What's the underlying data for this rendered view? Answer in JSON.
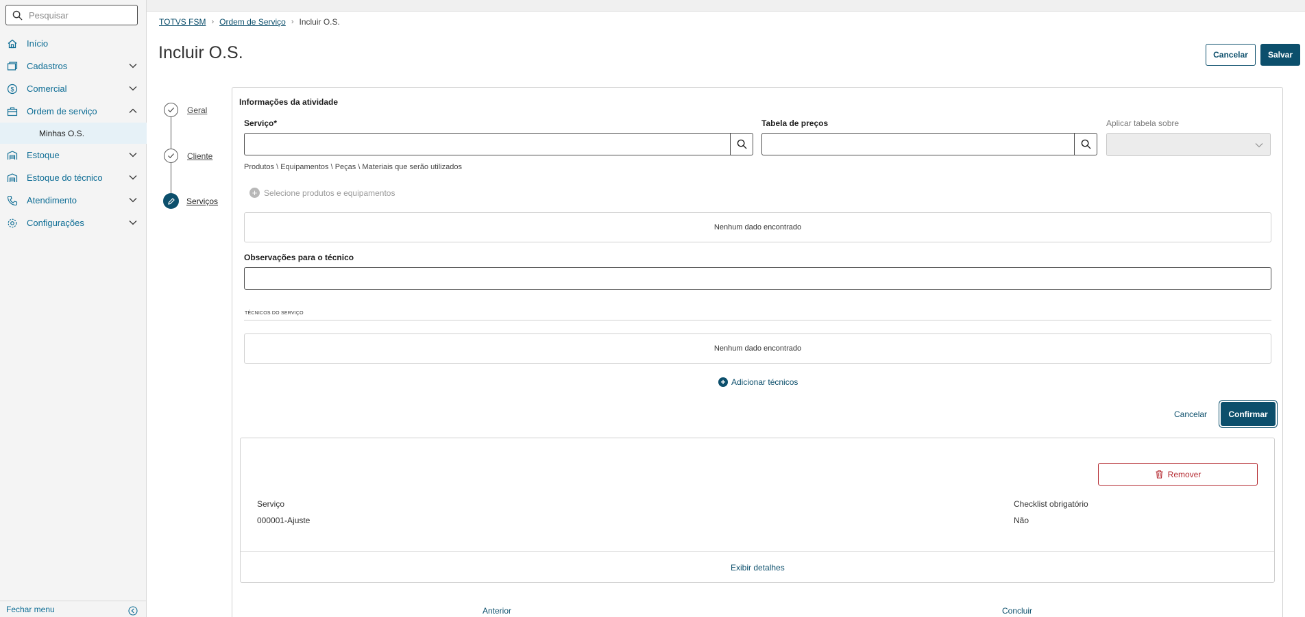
{
  "sidebar": {
    "search_placeholder": "Pesquisar",
    "items": [
      {
        "label": "Início",
        "icon": "home-icon"
      },
      {
        "label": "Cadastros",
        "icon": "cards-icon"
      },
      {
        "label": "Comercial",
        "icon": "dollar-icon"
      },
      {
        "label": "Ordem de serviço",
        "icon": "briefcase-icon"
      },
      {
        "label": "Estoque",
        "icon": "warehouse-icon"
      },
      {
        "label": "Estoque do técnico",
        "icon": "warehouse-icon"
      },
      {
        "label": "Atendimento",
        "icon": "phone-icon"
      },
      {
        "label": "Configurações",
        "icon": "gear-icon"
      }
    ],
    "subitem": "Minhas O.S.",
    "close_menu": "Fechar menu"
  },
  "breadcrumb": {
    "home": "TOTVS FSM",
    "parent": "Ordem de Serviço",
    "current": "Incluir O.S."
  },
  "page": {
    "title": "Incluir O.S.",
    "cancel": "Cancelar",
    "save": "Salvar"
  },
  "steps": [
    "Geral",
    "Cliente",
    "Serviços"
  ],
  "form": {
    "section_title": "Informações da atividade",
    "service_label": "Serviço*",
    "price_table_label": "Tabela de preços",
    "apply_table_label": "Aplicar tabela sobre",
    "products_hint": "Produtos \\ Equipamentos \\ Peças \\ Materiais que serão utilizados",
    "select_products": "Selecione produtos e equipamentos",
    "empty_text": "Nenhum dado encontrado",
    "notes_label": "Observações para o técnico",
    "techs_header": "TÉCNICOS DO SERVIÇO",
    "add_techs": "Adicionar técnicos",
    "cancel": "Cancelar",
    "confirm": "Confirmar"
  },
  "card": {
    "remove": "Remover",
    "service_label": "Serviço",
    "service_value": "000001-Ajuste",
    "checklist_label": "Checklist obrigatório",
    "checklist_value": "Não",
    "details_link": "Exibir detalhes"
  },
  "footer": {
    "previous": "Anterior",
    "finish": "Concluir"
  },
  "colors": {
    "primary": "#0c4f6c",
    "link": "#0c6c94",
    "danger": "#b3262d"
  }
}
